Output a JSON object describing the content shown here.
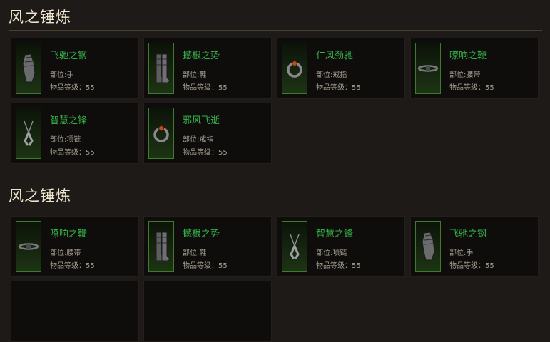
{
  "sections": [
    {
      "title": "风之锤炼",
      "items": [
        {
          "name": "飞驰之钢",
          "slot": "部位:手",
          "level": "物品等级：55",
          "icon": "gauntlet-icon"
        },
        {
          "name": "撼根之势",
          "slot": "部位:鞋",
          "level": "物品等级：55",
          "icon": "boots-icon"
        },
        {
          "name": "仁风劲驰",
          "slot": "部位:戒指",
          "level": "物品等级：55",
          "icon": "ring-icon"
        },
        {
          "name": "嘹响之鞭",
          "slot": "部位:腰带",
          "level": "物品等级：55",
          "icon": "belt-icon"
        },
        {
          "name": "智慧之锋",
          "slot": "部位:项链",
          "level": "物品等级：55",
          "icon": "amulet-icon"
        },
        {
          "name": "邪风飞逝",
          "slot": "部位:戒指",
          "level": "物品等级：55",
          "icon": "ring-icon"
        }
      ]
    },
    {
      "title": "风之锤炼",
      "items": [
        {
          "name": "嘹响之鞭",
          "slot": "部位:腰带",
          "level": "物品等级：55",
          "icon": "belt-icon"
        },
        {
          "name": "撼根之势",
          "slot": "部位:鞋",
          "level": "物品等级：55",
          "icon": "boots-icon"
        },
        {
          "name": "智慧之锋",
          "slot": "部位:项链",
          "level": "物品等级：55",
          "icon": "amulet-icon"
        },
        {
          "name": "飞驰之钢",
          "slot": "部位:手",
          "level": "物品等级：55",
          "icon": "gauntlet-icon"
        }
      ]
    }
  ]
}
